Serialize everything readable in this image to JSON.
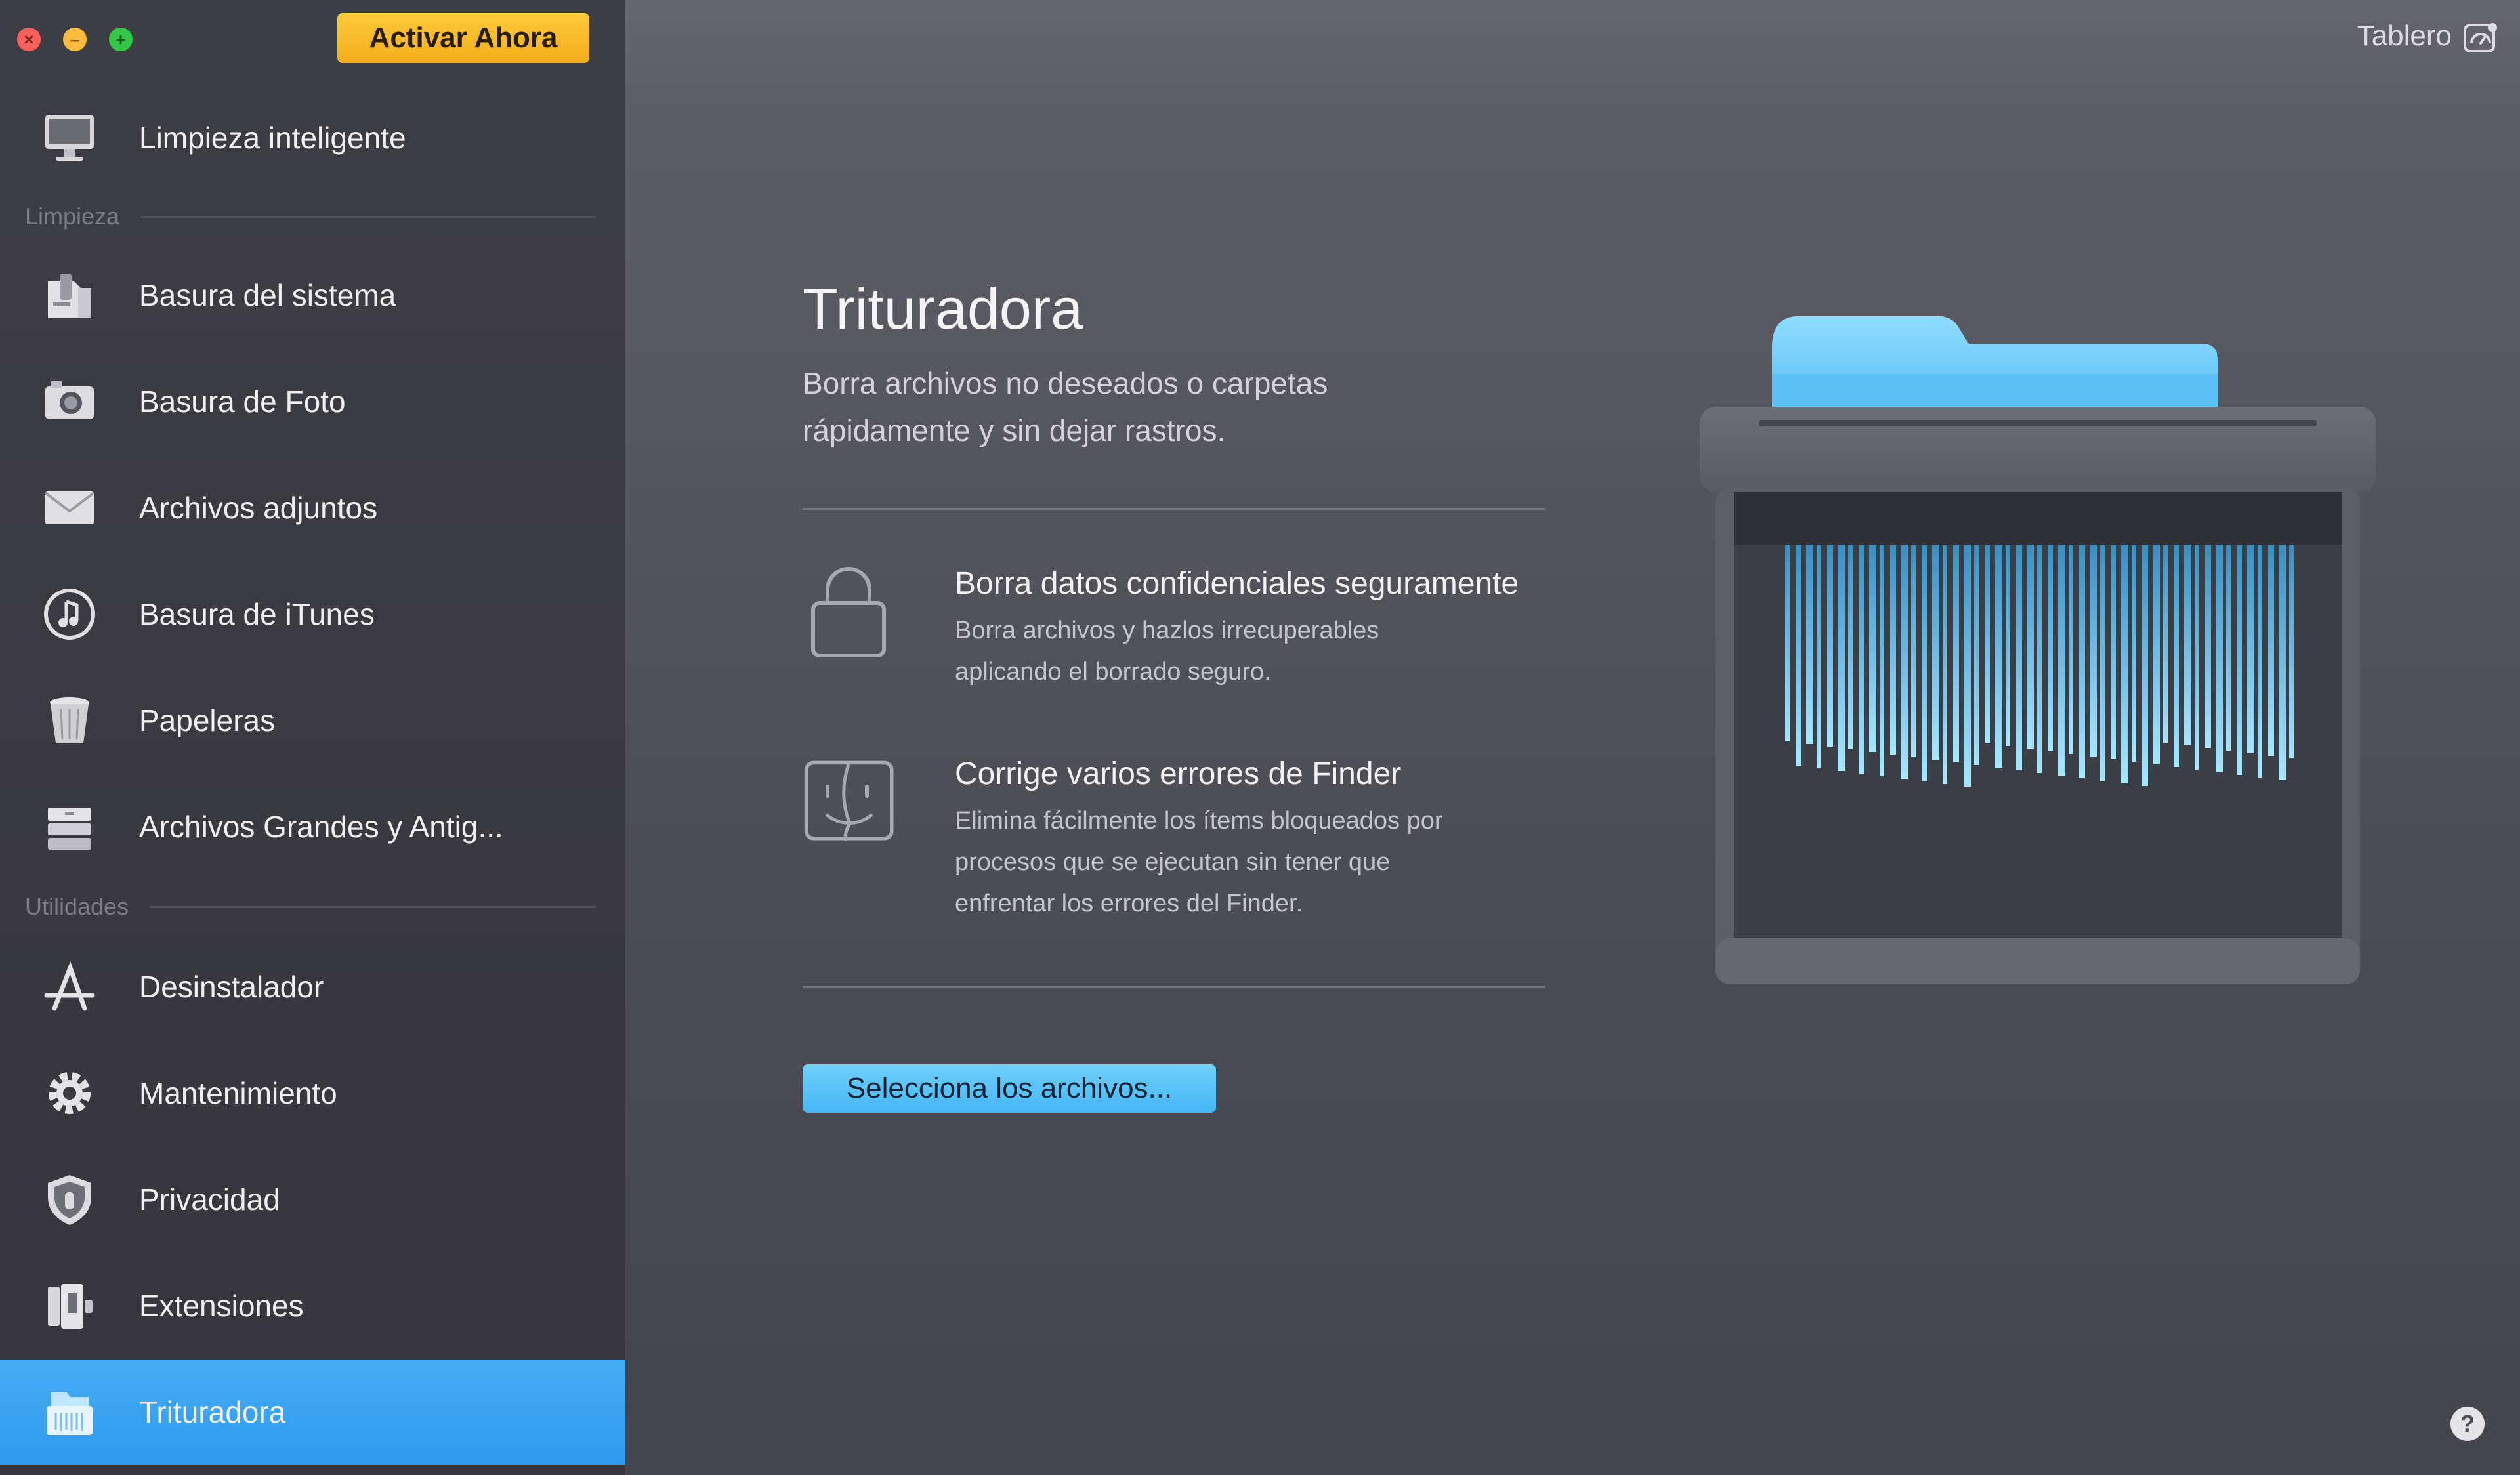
{
  "window": {
    "activate_label": "Activar Ahora"
  },
  "sidebar": {
    "top_item": {
      "label": "Limpieza inteligente",
      "icon": "monitor-icon"
    },
    "section_cleaning": "Limpieza",
    "cleaning_items": [
      {
        "label": "Basura del sistema",
        "icon": "system-junk-icon"
      },
      {
        "label": "Basura de Foto",
        "icon": "camera-icon"
      },
      {
        "label": "Archivos adjuntos",
        "icon": "envelope-icon"
      },
      {
        "label": "Basura de iTunes",
        "icon": "music-note-icon"
      },
      {
        "label": "Papeleras",
        "icon": "trash-icon"
      },
      {
        "label": "Archivos Grandes y Antig...",
        "icon": "file-cabinet-icon"
      }
    ],
    "section_utilities": "Utilidades",
    "utility_items": [
      {
        "label": "Desinstalador",
        "icon": "app-store-icon"
      },
      {
        "label": "Mantenimiento",
        "icon": "gear-icon"
      },
      {
        "label": "Privacidad",
        "icon": "shield-icon"
      },
      {
        "label": "Extensiones",
        "icon": "extensions-icon"
      },
      {
        "label": "Trituradora",
        "icon": "shredder-icon",
        "active": true
      }
    ]
  },
  "header": {
    "dashboard_label": "Tablero",
    "dashboard_icon": "dashboard-icon"
  },
  "main": {
    "title": "Trituradora",
    "subtitle_line1": "Borra archivos no deseados o carpetas",
    "subtitle_line2": "rápidamente y sin dejar rastros.",
    "features": [
      {
        "icon": "lock-icon",
        "title": "Borra datos confidenciales seguramente",
        "desc_line1": "Borra archivos y hazlos irrecuperables",
        "desc_line2": "aplicando el borrado seguro."
      },
      {
        "icon": "finder-icon",
        "title": "Corrige varios errores de Finder",
        "desc_line1": "Elimina fácilmente los ítems bloqueados por",
        "desc_line2": "procesos que se ejecutan sin tener que",
        "desc_line3": "enfrentar los errores del Finder."
      }
    ],
    "select_button": "Selecciona los archivos..."
  },
  "colors": {
    "accent": "#3aa6f4",
    "activate": "#f6b324",
    "sidebar_bg": "#3a3a40",
    "main_bg": "#55555d"
  }
}
